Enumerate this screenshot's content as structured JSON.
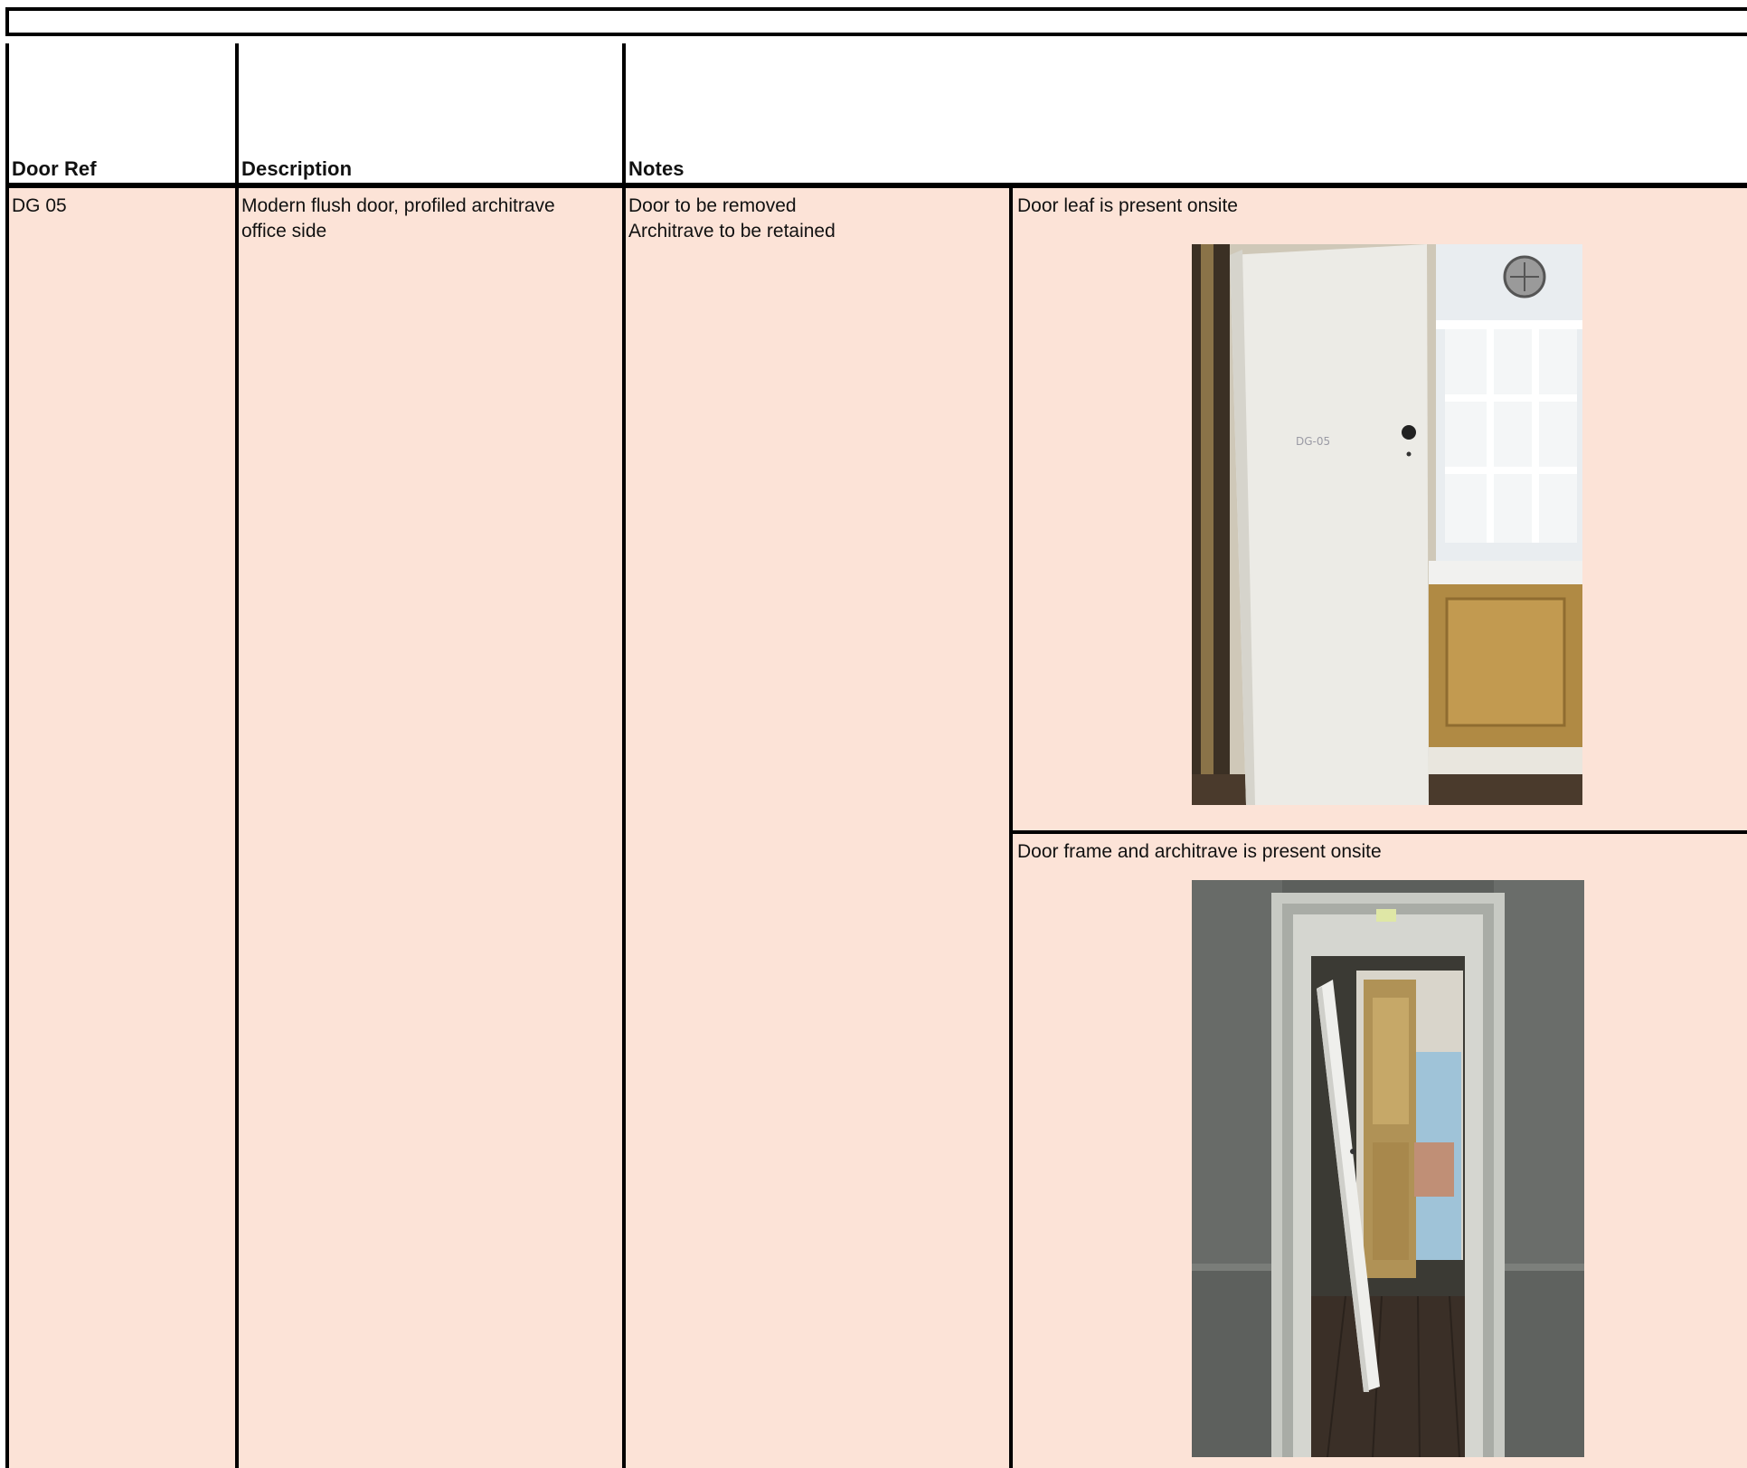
{
  "table": {
    "headers": {
      "door_ref": "Door Ref",
      "description": "Description",
      "notes": "Notes"
    },
    "rows": [
      {
        "door_ref": "DG 05",
        "description_lines": [
          "Modern flush door, profiled architrave",
          "office side"
        ],
        "notes_lines": [
          "Door to be removed",
          "Architrave to be retained"
        ],
        "photos": [
          {
            "caption": "Door leaf is present onsite",
            "subject": "door-leaf-photo"
          },
          {
            "caption": "Door frame and architrave is present onsite",
            "subject": "door-frame-photo"
          }
        ]
      }
    ]
  },
  "colors": {
    "row_fill": "#fce3d7",
    "rule": "#000000"
  }
}
